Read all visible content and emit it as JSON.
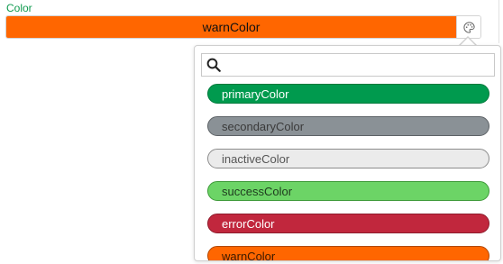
{
  "field": {
    "label": "Color",
    "value": "warnColor",
    "value_color": "#ff6600"
  },
  "palette_button": {
    "icon": "palette-icon"
  },
  "search": {
    "placeholder": "",
    "value": "",
    "icon": "search-icon"
  },
  "options": [
    {
      "label": "primaryColor",
      "bg": "#009a4e",
      "fg": "#ffffff",
      "border": "#007a3c"
    },
    {
      "label": "secondaryColor",
      "bg": "#8a9196",
      "fg": "#3a3a3a",
      "border": "#5d6266"
    },
    {
      "label": "inactiveColor",
      "bg": "#ebebeb",
      "fg": "#555555",
      "border": "#8c8c8c"
    },
    {
      "label": "successColor",
      "bg": "#6cd466",
      "fg": "#1e3a1e",
      "border": "#3f9a3a"
    },
    {
      "label": "errorColor",
      "bg": "#c1273d",
      "fg": "#ffffff",
      "border": "#8e1c2c"
    },
    {
      "label": "warnColor",
      "bg": "#ff6600",
      "fg": "#3a1a00",
      "border": "#b34700"
    }
  ]
}
